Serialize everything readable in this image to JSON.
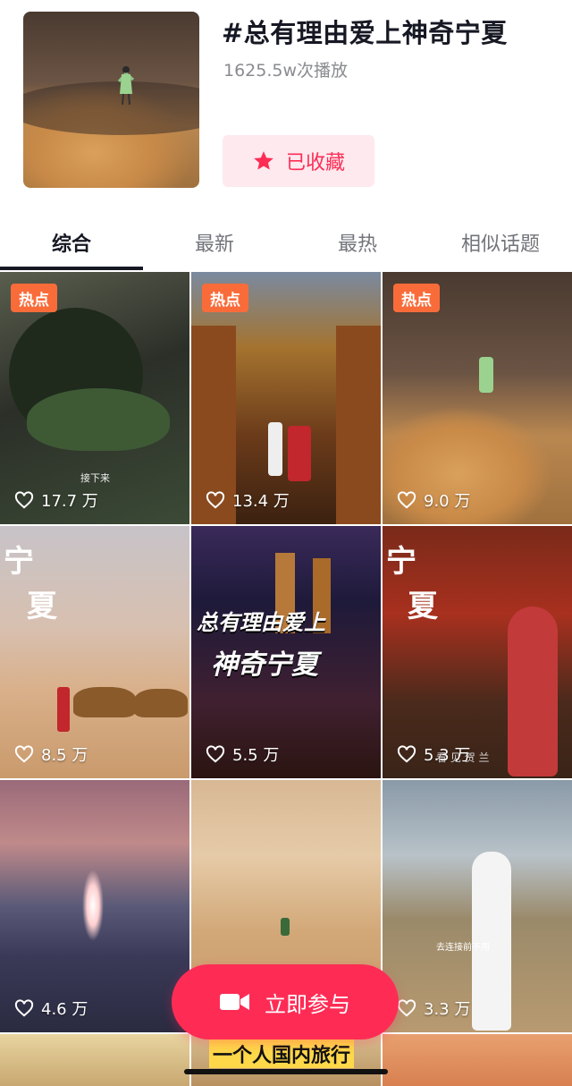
{
  "topic": {
    "title": "#总有理由爱上神奇宁夏",
    "plays": "1625.5w次播放",
    "favorite_label": "已收藏"
  },
  "tabs": [
    {
      "label": "综合",
      "active": true
    },
    {
      "label": "最新",
      "active": false
    },
    {
      "label": "最热",
      "active": false
    },
    {
      "label": "相似话题",
      "active": false
    }
  ],
  "videos": [
    {
      "likes": "17.7 万",
      "badge": "热点",
      "caption": "接下来"
    },
    {
      "likes": "13.4 万",
      "badge": "热点"
    },
    {
      "likes": "9.0 万",
      "badge": "热点"
    },
    {
      "likes": "8.5 万",
      "overlay": [
        "宁",
        "夏"
      ]
    },
    {
      "likes": "5.5 万",
      "overlay": [
        "总有理由爱上",
        "神奇宁夏"
      ]
    },
    {
      "likes": "5.3 万",
      "overlay": [
        "宁",
        "夏"
      ],
      "caption": "看 见 贺 兰"
    },
    {
      "likes": "4.6 万"
    },
    {
      "likes": ""
    },
    {
      "likes": "3.3 万",
      "caption": "去连接前不用"
    },
    {
      "likes": ""
    },
    {
      "likes": "",
      "overlay": [
        "一个人国内旅行"
      ]
    },
    {
      "likes": ""
    }
  ],
  "participate_label": "立即参与",
  "colors": {
    "accent": "#fe2c55",
    "badge": "#f96c3a"
  }
}
